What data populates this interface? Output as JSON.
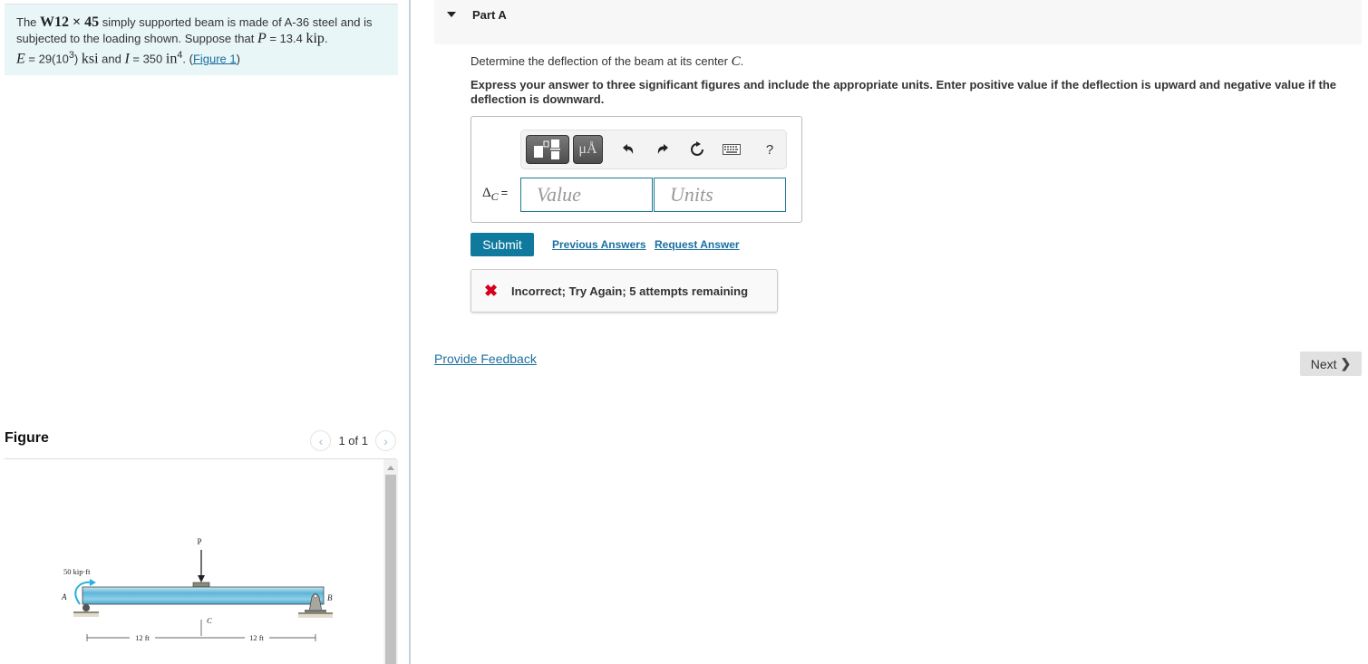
{
  "problem": {
    "text_1": "The ",
    "section": "W12 × 45",
    "text_2": " simply supported beam is made of A-36 steel and is subjected to the loading shown. Suppose that ",
    "p_symbol": "P",
    "p_eq": " = 13.4 ",
    "p_unit": "kip",
    "text_3": ".",
    "e_symbol": "E",
    "e_eq": " = 29(10",
    "e_exp": "3",
    "e_close": ") ",
    "e_unit": "ksi",
    "text_4": " and ",
    "i_symbol": "I",
    "i_eq": " = 350 ",
    "i_unit": "in",
    "i_exp": "4",
    "text_5": ". (",
    "figure_link": "Figure 1",
    "text_6": ")"
  },
  "figure": {
    "title": "Figure",
    "pager_text": "1 of 1",
    "prev_icon": "chevron-left-icon",
    "next_icon": "chevron-right-icon",
    "labels": {
      "load": "P",
      "moment": "50 kip·ft",
      "support_a": "A",
      "support_b": "B",
      "center": "C",
      "span_left": "12 ft",
      "span_right": "12 ft"
    }
  },
  "part": {
    "title": "Part A",
    "question_prefix": "Determine the deflection of the beam at its center ",
    "question_symbol": "C",
    "question_suffix": ".",
    "instructions": "Express your answer to three significant figures and include the appropriate units. Enter positive value if the deflection is upward and negative value if the deflection is downward."
  },
  "toolbar": {
    "templates_icon": "templates-icon",
    "units_label": "μÅ",
    "undo_icon": "undo-icon",
    "redo_icon": "redo-icon",
    "reset_icon": "reset-icon",
    "keyboard_icon": "keyboard-icon",
    "help_label": "?"
  },
  "answer": {
    "label_delta": "Δ",
    "label_sub": "C",
    "label_eq": "=",
    "value_placeholder": "Value",
    "units_placeholder": "Units"
  },
  "actions": {
    "submit": "Submit",
    "previous_answers": "Previous Answers",
    "request_answer": "Request Answer"
  },
  "feedback": {
    "status": "incorrect",
    "message": "Incorrect; Try Again; 5 attempts remaining",
    "icon_color": "#d6001c"
  },
  "footer": {
    "provide_feedback": "Provide Feedback",
    "next": "Next"
  },
  "colors": {
    "accent": "#0f7a9e",
    "link": "#1a6fa0",
    "problem_bg": "#e8f6f7"
  }
}
